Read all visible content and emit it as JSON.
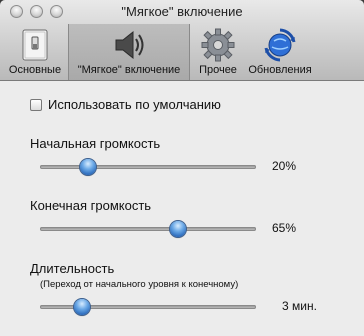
{
  "window": {
    "title": "\"Мягкое\" включение"
  },
  "toolbar": {
    "items": [
      {
        "label": "Основные",
        "icon": "switch-icon",
        "selected": false
      },
      {
        "label": "\"Мягкое\" включение",
        "icon": "speaker-icon",
        "selected": true
      },
      {
        "label": "Прочее",
        "icon": "gear-icon",
        "selected": false
      },
      {
        "label": "Обновления",
        "icon": "sync-globe-icon",
        "selected": false
      }
    ]
  },
  "settings": {
    "use_default": {
      "label": "Использовать по умолчанию",
      "checked": false
    },
    "start_volume": {
      "label": "Начальная громкость",
      "value_text": "20%",
      "position": 0.2
    },
    "end_volume": {
      "label": "Конечная громкость",
      "value_text": "65%",
      "position": 0.65
    },
    "duration": {
      "label": "Длительность",
      "sublabel": "(Переход от начального уровня к конечному)",
      "value_text": "3 мин.",
      "position": 0.17
    }
  },
  "colors": {
    "knob": "#3f7fcf",
    "selected_toolbar": "#b0b0b0"
  }
}
